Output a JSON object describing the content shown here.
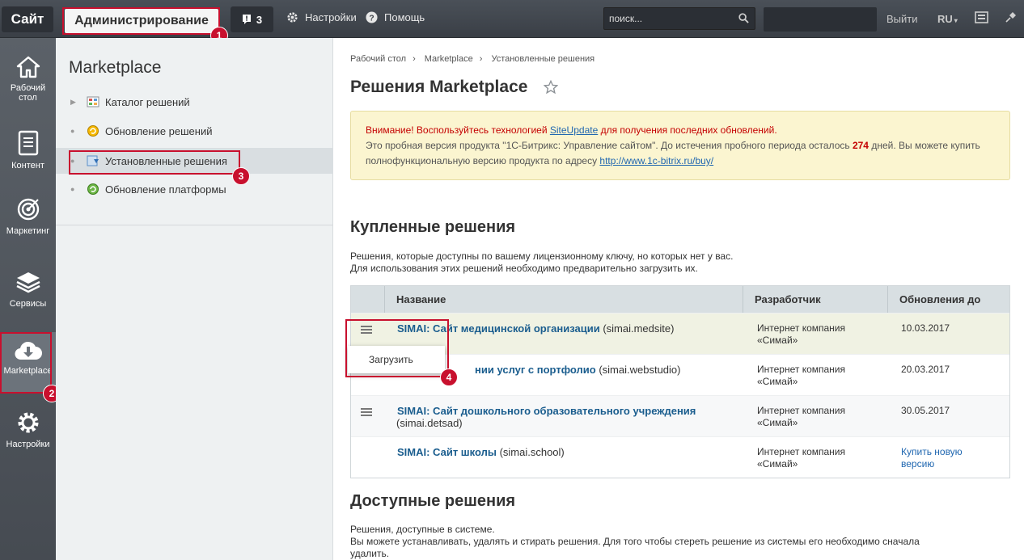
{
  "topbar": {
    "site": "Сайт",
    "admin": "Администрирование",
    "notifications": "3",
    "settings": "Настройки",
    "help": "Помощь",
    "search_placeholder": "поиск...",
    "logout": "Выйти",
    "lang": "RU"
  },
  "annotations": [
    "1",
    "2",
    "3",
    "4"
  ],
  "leftnav": {
    "items": [
      {
        "label": "Рабочий стол",
        "icon": "home-icon"
      },
      {
        "label": "Контент",
        "icon": "document-icon"
      },
      {
        "label": "Маркетинг",
        "icon": "target-icon"
      },
      {
        "label": "Сервисы",
        "icon": "layers-icon"
      },
      {
        "label": "Marketplace",
        "icon": "cloud-download-icon"
      },
      {
        "label": "Настройки",
        "icon": "gear-icon"
      }
    ]
  },
  "menu": {
    "title": "Marketplace",
    "items": [
      {
        "label": "Каталог решений"
      },
      {
        "label": "Обновление решений"
      },
      {
        "label": "Установленные решения"
      },
      {
        "label": "Обновление платформы"
      }
    ]
  },
  "breadcrumb": [
    "Рабочий стол",
    "Marketplace",
    "Установленные решения"
  ],
  "page_title": "Решения Marketplace",
  "notice": {
    "warn_prefix": "Внимание! Воспользуйтесь технологией ",
    "warn_link": "SiteUpdate",
    "warn_suffix": " для получения последних обновлений.",
    "text1": "Это пробная версия продукта \"1С-Битрикс: Управление сайтом\". До истечения пробного периода осталось ",
    "days": "274",
    "text2": " дней. Вы можете купить полнофункциональную версию продукта по адресу ",
    "url": "http://www.1c-bitrix.ru/buy/"
  },
  "purchased": {
    "title": "Купленные решения",
    "desc1": "Решения, которые доступны по вашему лицензионному ключу, но которых нет у вас.",
    "desc2": "Для использования этих решений необходимо предварительно загрузить их.",
    "headers": [
      "Название",
      "Разработчик",
      "Обновления до"
    ],
    "rows": [
      {
        "name": "SIMAI: Сайт медицинской организации",
        "code": " (simai.medsite)",
        "dev1": "Интернет компания",
        "dev2": "«Симай»",
        "date": "10.03.2017"
      },
      {
        "name": "нии услуг с портфолио",
        "code": " (simai.webstudio)",
        "dev1": "Интернет компания",
        "dev2": "«Симай»",
        "date": "20.03.2017"
      },
      {
        "name": "SIMAI: Сайт дошкольного образовательного учреждения",
        "code": "(simai.detsad)",
        "dev1": "Интернет компания",
        "dev2": "«Симай»",
        "date": "30.05.2017"
      },
      {
        "name": "SIMAI: Сайт школы",
        "code": " (simai.school)",
        "dev1": "Интернет компания",
        "dev2": "«Симай»",
        "buy1": "Купить новую",
        "buy2": "версию"
      }
    ],
    "popup": "Загрузить"
  },
  "available": {
    "title": "Доступные решения",
    "desc1": "Решения, доступные в системе.",
    "desc2": "Вы можете устанавливать, удалять и стирать решения. Для того чтобы стереть решение из системы его необходимо сначала",
    "desc3": "удалить."
  },
  "colors": {
    "annotation": "#c8102e",
    "link": "#1a5d8e",
    "warning": "#c40000"
  }
}
